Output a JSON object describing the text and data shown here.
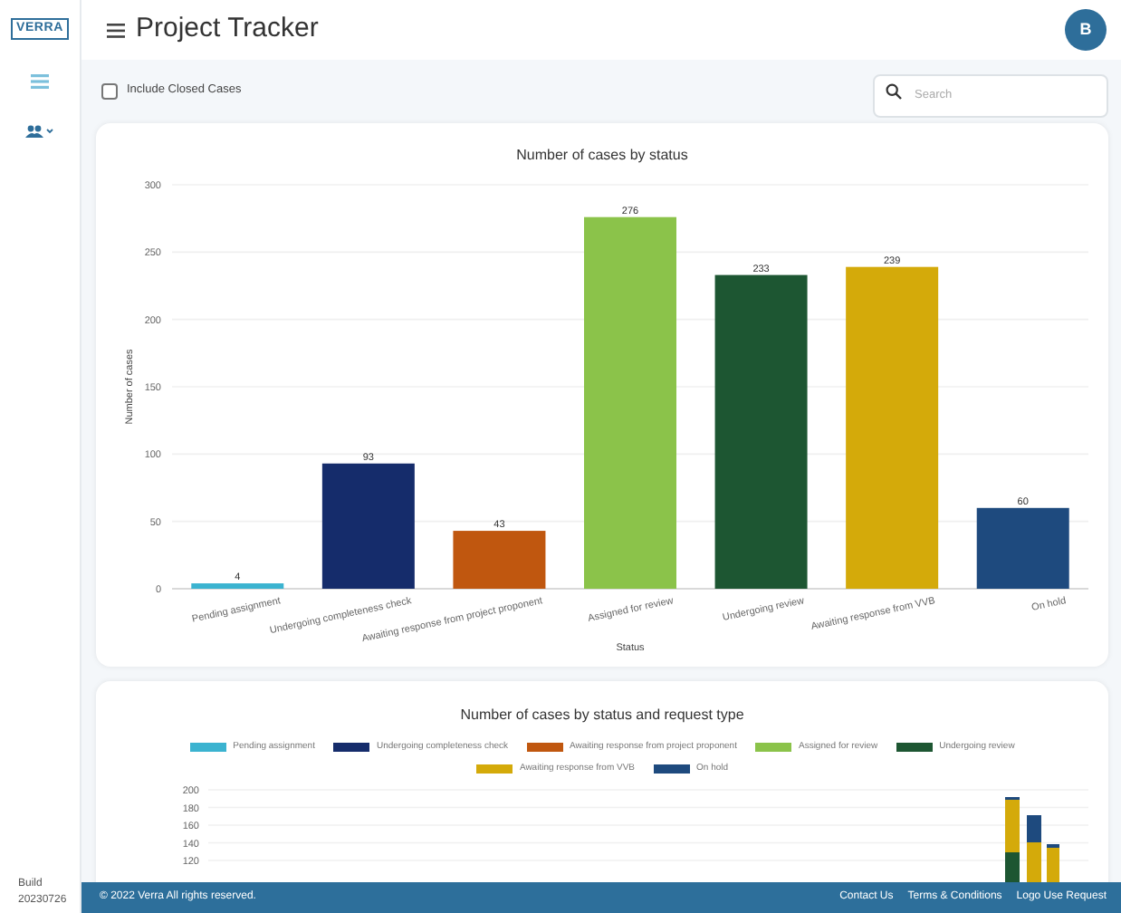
{
  "logo": {
    "text": "VERRA"
  },
  "sidebar": {
    "build_label": "Build",
    "build_number": "20230726"
  },
  "header": {
    "title": "Project Tracker",
    "avatar": "B"
  },
  "filters": {
    "include_closed": {
      "label": "Include Closed Cases",
      "checked": false
    },
    "search": {
      "placeholder": "Search"
    }
  },
  "status_chart": {
    "chart_data": {
      "type": "bar",
      "title": "Number of cases by status",
      "xlabel": "Status",
      "ylabel": "Number of cases",
      "categories": [
        "Pending assignment",
        "Undergoing completeness check",
        "Awaiting response from project proponent",
        "Assigned for review",
        "Undergoing review",
        "Awaiting response from VVB",
        "On hold"
      ],
      "series": [
        {
          "color": "#3bb3d0",
          "values": [
            4,
            null,
            null,
            null,
            null,
            null,
            null
          ]
        },
        {
          "color": "#152c6b",
          "values": [
            null,
            93,
            null,
            null,
            null,
            null,
            null
          ]
        },
        {
          "color": "#c0570f",
          "values": [
            null,
            null,
            43,
            null,
            null,
            null,
            null
          ]
        },
        {
          "color": "#8bc34a",
          "values": [
            null,
            null,
            null,
            276,
            null,
            null,
            null
          ]
        },
        {
          "color": "#1d5632",
          "values": [
            null,
            null,
            null,
            null,
            233,
            null,
            null
          ]
        },
        {
          "color": "#d4aa0a",
          "values": [
            null,
            null,
            null,
            null,
            null,
            239,
            null
          ]
        },
        {
          "color": "#1e4a7e",
          "values": [
            null,
            null,
            null,
            null,
            null,
            null,
            60
          ]
        }
      ],
      "stacked": true,
      "grid": true,
      "ylim": [
        0,
        300
      ],
      "yticks": [
        0,
        50,
        100,
        150,
        200,
        250,
        300
      ],
      "data_labels": true
    }
  },
  "status_request_chart": {
    "title": "Number of cases by status and request type",
    "legend": [
      {
        "label": "Pending assignment",
        "color": "#3bb3d0"
      },
      {
        "label": "Undergoing completeness check",
        "color": "#152c6b"
      },
      {
        "label": "Awaiting response from project proponent",
        "color": "#c0570f"
      },
      {
        "label": "Assigned for review",
        "color": "#8bc34a"
      },
      {
        "label": "Undergoing review",
        "color": "#1d5632"
      },
      {
        "label": "Awaiting response from VVB",
        "color": "#d4aa0a"
      },
      {
        "label": "On hold",
        "color": "#1e4a7e"
      }
    ],
    "y_ticks": [
      "200",
      "180",
      "160",
      "140",
      "120"
    ]
  },
  "footer": {
    "copyright": "© 2022 Verra All rights reserved.",
    "links": [
      "Contact Us",
      "Terms & Conditions",
      "Logo Use Request"
    ]
  }
}
